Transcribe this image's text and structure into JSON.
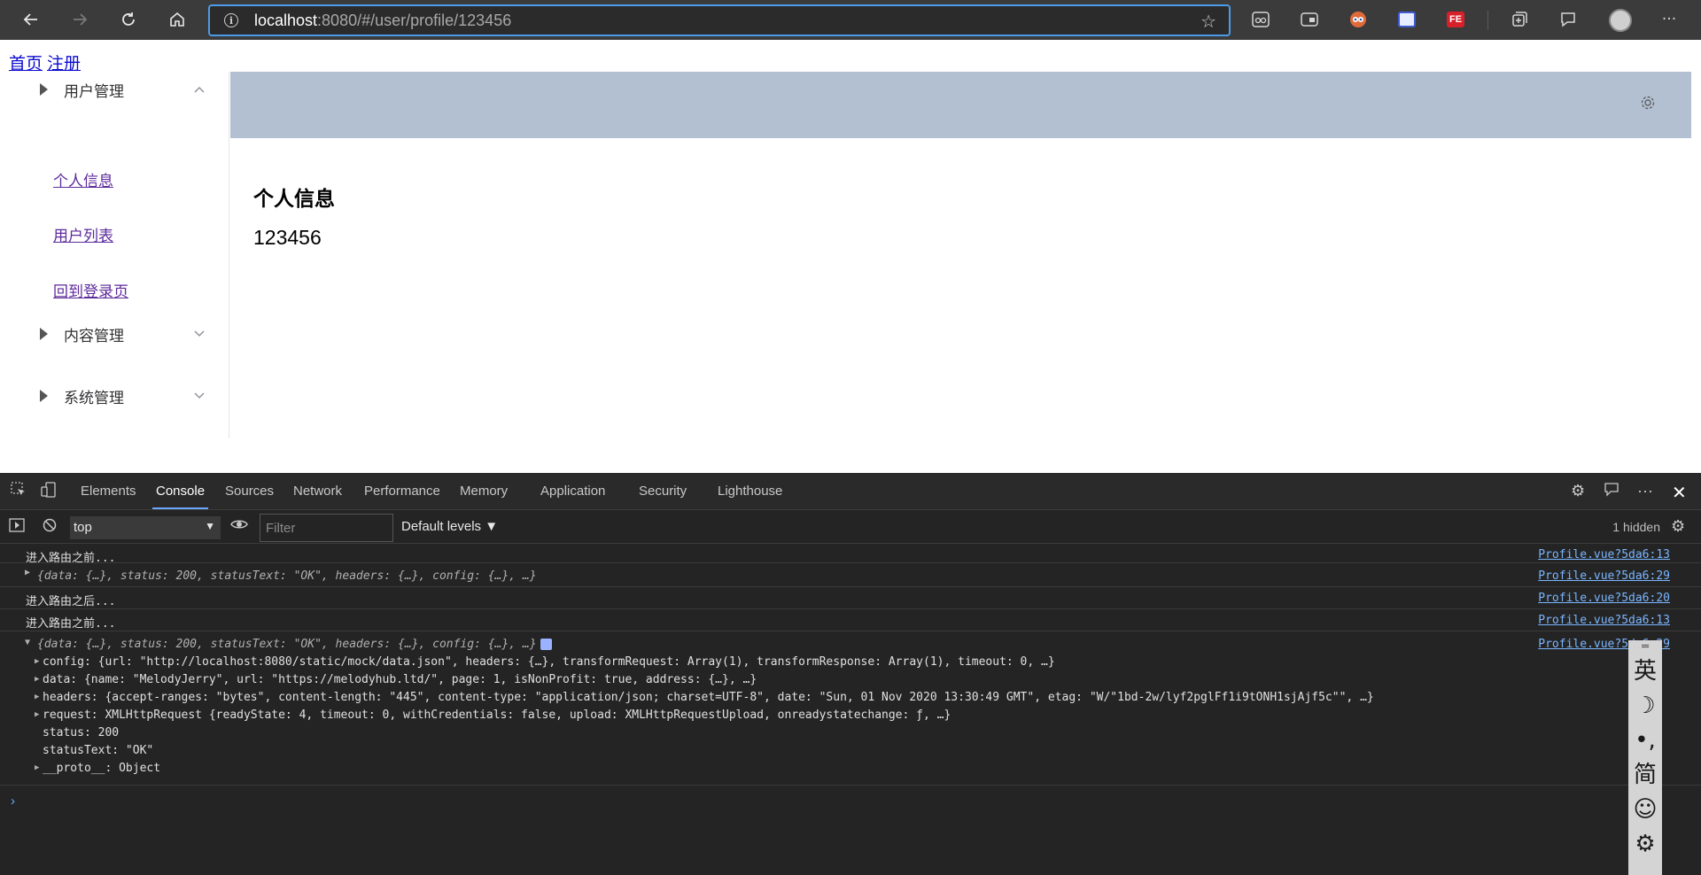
{
  "browser": {
    "url_host": "localhost",
    "url_rest": ":8080/#/user/profile/123456",
    "info_glyph": "i",
    "back_icon": "arrow-left-icon",
    "forward_icon": "arrow-right-icon",
    "refresh_icon": "refresh-icon",
    "home_icon": "home-icon",
    "star_icon": "star-icon",
    "extensions": [
      "reading-view-icon",
      "sidebar-icon",
      "avatar-ext-icon",
      "tab-icon",
      "fe-ext-icon",
      "collections-icon",
      "feedback-icon"
    ],
    "fe_label": "FE"
  },
  "page": {
    "top_links": [
      "首页",
      "注册"
    ],
    "sidebar": {
      "menus": [
        {
          "label": "用户管理",
          "expanded": true,
          "items": [
            "个人信息",
            "用户列表",
            "回到登录页"
          ]
        },
        {
          "label": "内容管理",
          "expanded": false
        },
        {
          "label": "系统管理",
          "expanded": false
        }
      ]
    },
    "content": {
      "title": "个人信息",
      "value": "123456"
    },
    "colors": {
      "header_bg": "#b3c0d1",
      "link": "#5d2a9c"
    }
  },
  "devtools": {
    "tabs": [
      "Elements",
      "Console",
      "Sources",
      "Network",
      "Performance",
      "Memory",
      "Application",
      "Security",
      "Lighthouse"
    ],
    "active_tab": "Console",
    "context": "top",
    "filter_placeholder": "Filter",
    "levels": "Default levels ▼",
    "hidden": "1 hidden",
    "logs": [
      {
        "text": "进入路由之前...",
        "src": "Profile.vue?5da6:13"
      },
      {
        "text": "{data: {…}, status: 200, statusText: \"OK\", headers: {…}, config: {…}, …}",
        "src": "Profile.vue?5da6:29"
      },
      {
        "text": "进入路由之后...",
        "src": "Profile.vue?5da6:20"
      },
      {
        "text": "进入路由之前...",
        "src": "Profile.vue?5da6:13"
      },
      {
        "text": "{data: {…}, status: 200, statusText: \"OK\", headers: {…}, config: {…}, …}",
        "src": "Profile.vue?5da6:29"
      }
    ],
    "expanded_props": [
      "config: {url: \"http://localhost:8080/static/mock/data.json\", headers: {…}, transformRequest: Array(1), transformResponse: Array(1), timeout: 0, …}",
      "data: {name: \"MelodyJerry\", url: \"https://melodyhub.ltd/\", page: 1, isNonProfit: true, address: {…}, …}",
      "headers: {accept-ranges: \"bytes\", content-length: \"445\", content-type: \"application/json; charset=UTF-8\", date: \"Sun, 01 Nov 2020 13:30:49 GMT\", etag: \"W/\"1bd-2w/lyf2pglFf1i9tONH1sjAjf5c\"\", …}",
      "request: XMLHttpRequest {readyState: 4, timeout: 0, withCredentials: false, upload: XMLHttpRequestUpload, onreadystatechange: ƒ, …}",
      "status: 200",
      "statusText: \"OK\"",
      "__proto__: Object"
    ],
    "prompt": "›"
  },
  "ime": {
    "handle": "═",
    "items": [
      "英",
      "☽",
      "•,",
      "简",
      "☺",
      "⚙"
    ]
  }
}
